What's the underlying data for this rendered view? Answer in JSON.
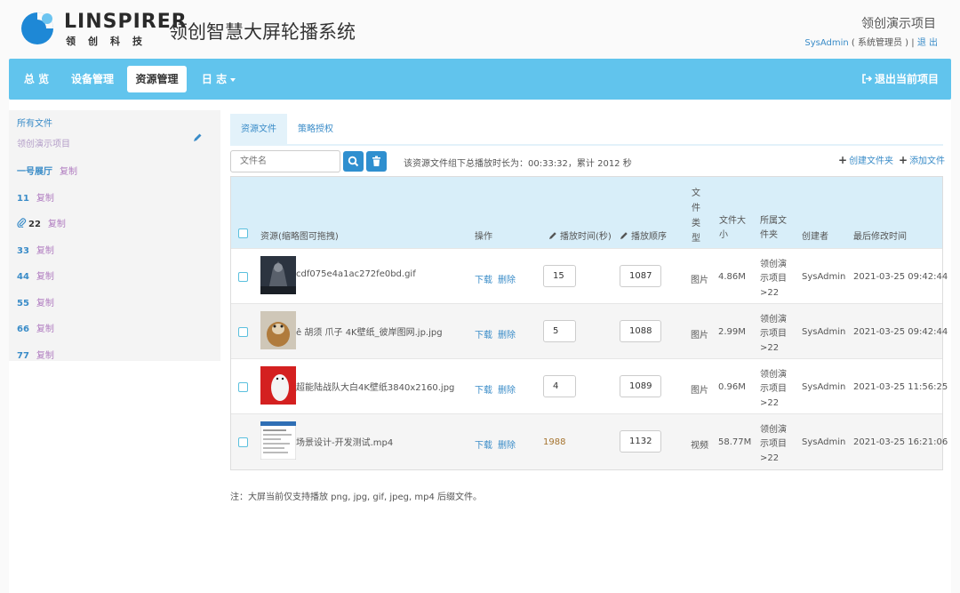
{
  "header": {
    "logo_text": "LINSPIRER",
    "logo_sub": "领创科技",
    "app_title": "领创智慧大屏轮播系统",
    "project_name": "领创演示项目",
    "user_name": "SysAdmin",
    "user_role": "( 系统管理员 )",
    "separator": " | ",
    "logout": "退 出"
  },
  "nav": {
    "items": [
      {
        "label": "总 览"
      },
      {
        "label": "设备管理"
      },
      {
        "label": "资源管理"
      },
      {
        "label": "日 志"
      }
    ],
    "exit_label": "退出当前项目"
  },
  "sidebar": {
    "all_files": "所有文件",
    "project": "领创演示项目",
    "copy_label": "复制",
    "folders": [
      {
        "name": "一号展厅"
      },
      {
        "name": "11"
      },
      {
        "name": "22"
      },
      {
        "name": "33"
      },
      {
        "name": "44"
      },
      {
        "name": "55"
      },
      {
        "name": "66"
      },
      {
        "name": "77"
      }
    ]
  },
  "tabs": [
    {
      "label": "资源文件"
    },
    {
      "label": "策略授权"
    }
  ],
  "toolbar": {
    "search_placeholder": "文件名",
    "summary": "该资源文件组下总播放时长为：00:33:32，累计 2012 秒",
    "create_folder": "创建文件夹",
    "add_file": "添加文件"
  },
  "table": {
    "headers": {
      "resource": "资源(缩略图可拖拽)",
      "ops": "操作",
      "duration": "播放时间(秒)",
      "order": "播放顺序",
      "type_1": "文",
      "type_2": "件",
      "type_3": "类",
      "type_4": "型",
      "size_1": "文件大",
      "size_2": "小",
      "folder_1": "所属文",
      "folder_2": "件夹",
      "creator": "创建者",
      "modified": "最后修改时间"
    },
    "download": "下载",
    "delete": "删除",
    "rows": [
      {
        "name": "cdf075e4a1ac272fe0bd.gif",
        "duration": "15",
        "order": "1087",
        "type": "图片",
        "size": "4.86M",
        "folder_1": "领创演",
        "folder_2": "示项目",
        "folder_3": ">22",
        "creator": "SysAdmin",
        "modified": "2021-03-25 09:42:44"
      },
      {
        "name": "ê 胡须 爪子 4K壁纸_彼岸图网.jp.jpg",
        "duration": "5",
        "order": "1088",
        "type": "图片",
        "size": "2.99M",
        "folder_1": "领创演",
        "folder_2": "示项目",
        "folder_3": ">22",
        "creator": "SysAdmin",
        "modified": "2021-03-25 09:42:44"
      },
      {
        "name": "超能陆战队大白4K壁纸3840x2160.jpg",
        "duration": "4",
        "order": "1089",
        "type": "图片",
        "size": "0.96M",
        "folder_1": "领创演",
        "folder_2": "示项目",
        "folder_3": ">22",
        "creator": "SysAdmin",
        "modified": "2021-03-25 11:56:25"
      },
      {
        "name": "场景设计-开发测试.mp4",
        "duration": "1988",
        "order": "1132",
        "type": "视频",
        "size": "58.77M",
        "folder_1": "领创演",
        "folder_2": "示项目",
        "folder_3": ">22",
        "creator": "SysAdmin",
        "modified": "2021-03-25 16:21:06"
      }
    ]
  },
  "note": "注：大屏当前仅支持播放 png, jpg, gif, jpeg, mp4 后缀文件。"
}
